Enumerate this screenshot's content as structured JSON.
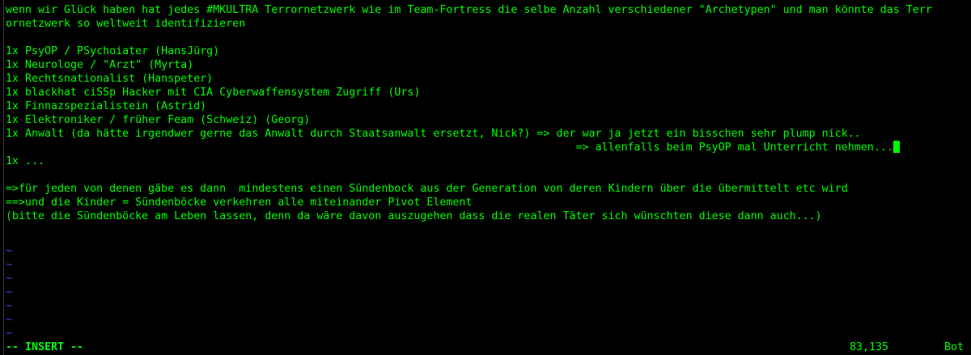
{
  "editor": {
    "lines": {
      "l1": "wenn wir Glück haben hat jedes #MKULTRA Terrornetzwerk wie im Team-Fortress die selbe Anzahl verschiedener \"Archetypen\" und man könnte das Terr",
      "l2": "ornetzwerk so weltweit identifizieren",
      "l4": "1x PsyOP / PSychoiater (HansJürg)",
      "l5": "1x Neurologe / \"Arzt\" (Myrta)",
      "l6": "1x Rechtsnationalist (Hanspeter)",
      "l7": "1x blackhat ciSSp Hacker mit CIA Cyberwaffensystem Zugriff (Urs)",
      "l8": "1x Finnazspezialistein (Astrid)",
      "l9": "1x Elektroniker / früher Feam (Schweiz) (Georg)",
      "l10": "1x Anwalt (da hätte irgendwer gerne das Anwalt durch Staatsanwalt ersetzt, Nick?) => der war ja jetzt ein bisschen sehr plump nick..",
      "l11": "                                                                                        => allenfalls beim PsyOP mal Unterricht nehmen...",
      "l12": "1x ...",
      "l14": "=>für jeden von denen gäbe es dann  mindestens einen Sündenbock aus der Generation von deren Kindern über die übermittelt etc wird",
      "l15": "==>und die Kinder = Sündenböcke verkehren alle miteinander Pivot Element",
      "l16": "(bitte die Sündenböcke am Leben lassen, denn da wäre davon auszugehen dass die realen Täter sich wünschten diese dann auch...)"
    },
    "empty_marker": "~",
    "status": {
      "mode": "-- INSERT --",
      "position": "83,135",
      "scroll": "Bot"
    },
    "colors": {
      "text": "#00ff00",
      "background": "#000000",
      "tilde": "#4040ff"
    }
  }
}
